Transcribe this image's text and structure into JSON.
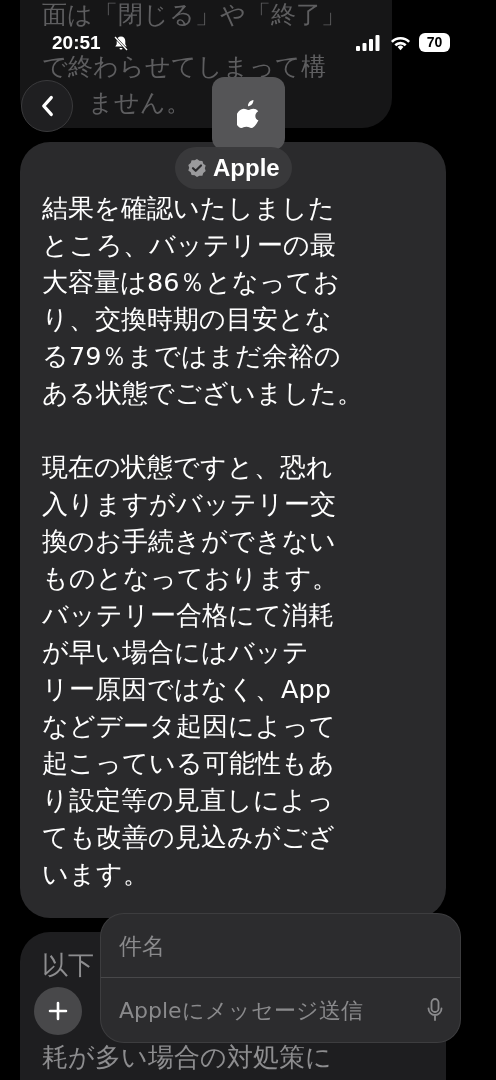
{
  "status_bar": {
    "time": "20:51",
    "silent": true,
    "battery": "70"
  },
  "header": {
    "name": "Apple",
    "verified": true
  },
  "messages": [
    {
      "kind": "partial",
      "lines": [
        "面は「閉じる」や「終了」",
        "で終わらせてしまって構",
        "ません。"
      ]
    },
    {
      "kind": "full",
      "paragraphs": [
        {
          "lines": [
            "結果を確認いたしました",
            "ところ、バッテリーの最",
            "大容量は86％となってお",
            "り、交換時期の目安とな",
            "る79％まではまだ余裕の",
            "ある状態でございました。"
          ]
        },
        {
          "lines": [
            "現在の状態ですと、恐れ",
            "入りますがバッテリー交",
            "換のお手続きができない",
            "ものとなっております。",
            "バッテリー合格にて消耗",
            "が早い場合にはバッテ",
            "リー原因ではなく、App",
            "などデータ起因によって",
            "起こっている可能性もあ",
            "り設定等の見直しによっ",
            "ても改善の見込みがござ",
            "います。"
          ]
        }
      ]
    },
    {
      "kind": "covered",
      "lines": [
        "以下",
        "耗が多い場合の対処策に"
      ]
    }
  ],
  "composer": {
    "subject_placeholder": "件名",
    "message_placeholder": "Appleにメッセージ送信"
  }
}
